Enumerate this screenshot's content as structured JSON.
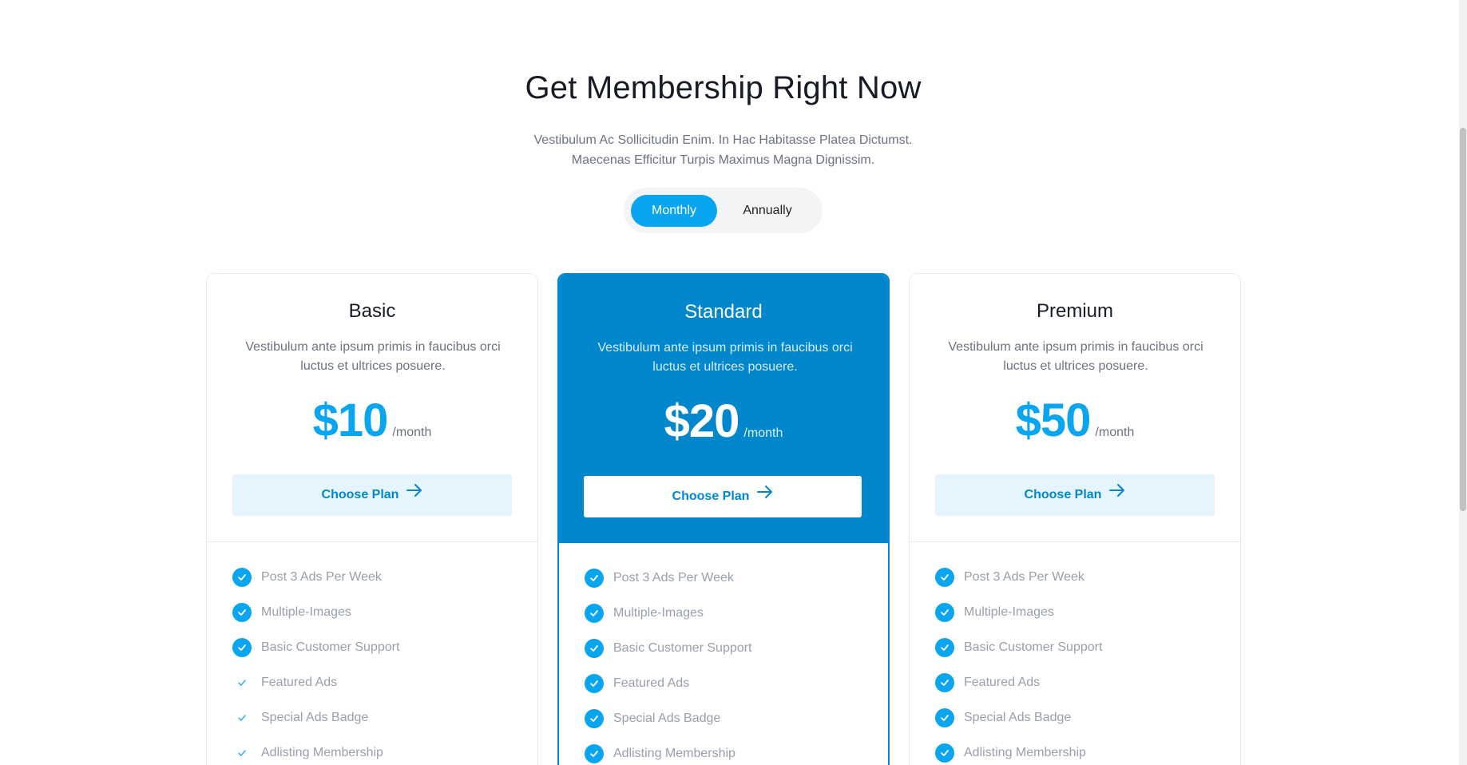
{
  "header": {
    "title": "Get Membership Right Now",
    "subtitle_line1": "Vestibulum Ac Sollicitudin Enim. In Hac Habitasse Platea Dictumst.",
    "subtitle_line2": "Maecenas Efficitur Turpis Maximus Magna Dignissim."
  },
  "billing_toggle": {
    "options": [
      "Monthly",
      "Annually"
    ],
    "selected": "Monthly"
  },
  "plans": [
    {
      "name": "Basic",
      "description": "Vestibulum ante ipsum primis in faucibus orci luctus et ultrices posuere.",
      "price": "$10",
      "period": "/month",
      "button_label": "Choose Plan",
      "featured": false,
      "features": [
        {
          "label": "Post 3 Ads Per Week",
          "included": true
        },
        {
          "label": "Multiple-Images",
          "included": true
        },
        {
          "label": "Basic Customer Support",
          "included": true
        },
        {
          "label": "Featured Ads",
          "included": false
        },
        {
          "label": "Special Ads Badge",
          "included": false
        },
        {
          "label": "Adlisting Membership",
          "included": false
        }
      ]
    },
    {
      "name": "Standard",
      "description": "Vestibulum ante ipsum primis in faucibus orci luctus et ultrices posuere.",
      "price": "$20",
      "period": "/month",
      "button_label": "Choose Plan",
      "featured": true,
      "features": [
        {
          "label": "Post 3 Ads Per Week",
          "included": true
        },
        {
          "label": "Multiple-Images",
          "included": true
        },
        {
          "label": "Basic Customer Support",
          "included": true
        },
        {
          "label": "Featured Ads",
          "included": true
        },
        {
          "label": "Special Ads Badge",
          "included": true
        },
        {
          "label": "Adlisting Membership",
          "included": true
        }
      ]
    },
    {
      "name": "Premium",
      "description": "Vestibulum ante ipsum primis in faucibus orci luctus et ultrices posuere.",
      "price": "$50",
      "period": "/month",
      "button_label": "Choose Plan",
      "featured": false,
      "features": [
        {
          "label": "Post 3 Ads Per Week",
          "included": true
        },
        {
          "label": "Multiple-Images",
          "included": true
        },
        {
          "label": "Basic Customer Support",
          "included": true
        },
        {
          "label": "Featured Ads",
          "included": true
        },
        {
          "label": "Special Ads Badge",
          "included": true
        },
        {
          "label": "Adlisting Membership",
          "included": true
        }
      ]
    }
  ],
  "colors": {
    "accent": "#0aa5f1",
    "featured_bg": "#0287cc",
    "button_bg": "#e6f5fd"
  },
  "icons": {
    "included": "check-circle-icon",
    "not_included": "check-icon",
    "button": "arrow-right-icon"
  }
}
